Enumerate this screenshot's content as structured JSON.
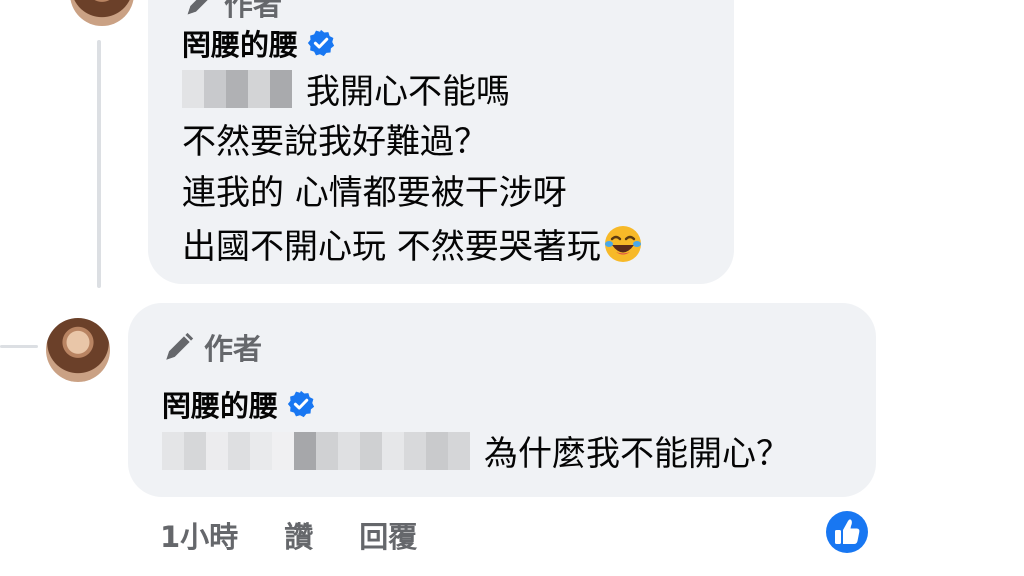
{
  "comment1": {
    "author_badge": "作者",
    "name": "罔腰的腰",
    "lines": [
      "我開心不能嗎",
      "不然要說我好難過？",
      "連我的 心情都要被干涉呀",
      "出國不開心玩 不然要哭著玩"
    ],
    "emoji": "face-with-tears-of-joy"
  },
  "comment2": {
    "author_badge": "作者",
    "name": "罔腰的腰",
    "text": "為什麼我不能開心？"
  },
  "actions": {
    "time": "1小時",
    "like": "讚",
    "reply": "回覆"
  },
  "colors": {
    "bubble": "#f0f2f5",
    "meta_text": "#65676b",
    "verified": "#1877f2",
    "like_reaction": "#1877f2"
  },
  "icons": [
    "pencil-icon",
    "verified-badge-icon",
    "laughing-emoji-icon",
    "thumbs-up-reaction-icon"
  ]
}
